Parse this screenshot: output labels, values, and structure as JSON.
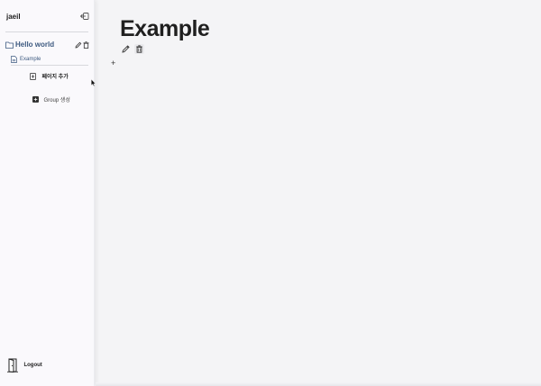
{
  "sidebar": {
    "username": "jaeil",
    "folder": {
      "label": "Hello world"
    },
    "pages": [
      {
        "label": "Example"
      }
    ],
    "add_page_label": "페이지 추가",
    "create_group_label": "Group 생성",
    "logout_label": "Logout"
  },
  "main": {
    "title": "Example",
    "add_block_label": "+"
  },
  "colors": {
    "accent": "#3d5a80",
    "sidebar_bg": "#faf9fc",
    "main_bg": "#f4f4f6"
  },
  "icons": [
    "sidebar-collapse-icon",
    "folder-icon",
    "pencil-icon",
    "trash-icon",
    "document-icon",
    "add-page-icon",
    "add-group-icon",
    "door-icon",
    "mouse-cursor-icon"
  ]
}
